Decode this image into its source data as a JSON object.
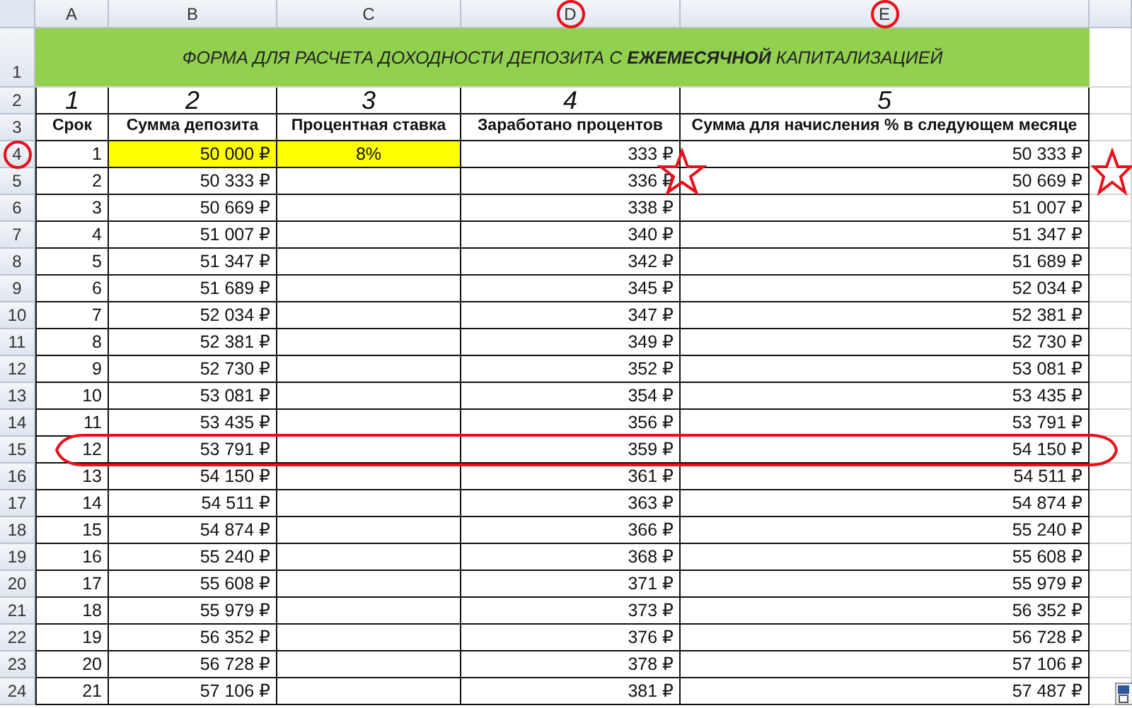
{
  "columns": [
    "A",
    "B",
    "C",
    "D",
    "E"
  ],
  "title": "ФОРМА ДЛЯ РАСЧЕТА ДОХОДНОСТИ ДЕПОЗИТА С **ЕЖЕМЕСЯЧНОЙ** КАПИТАЛИЗАЦИЕЙ",
  "column_numbers": [
    "1",
    "2",
    "3",
    "4",
    "5"
  ],
  "headers": [
    "Срок",
    "Сумма депозита",
    "Процентная ставка",
    "Заработано процентов",
    "Сумма для начисления % в следующем месяце"
  ],
  "rows": [
    {
      "term": "1",
      "deposit": "50 000 ₽",
      "rate": "8%",
      "interest": "333 ₽",
      "next": "50 333 ₽",
      "highlighted": true
    },
    {
      "term": "2",
      "deposit": "50 333 ₽",
      "interest": "336 ₽",
      "next": "50 669 ₽",
      "highlighted": false
    },
    {
      "term": "3",
      "deposit": "50 669 ₽",
      "interest": "338 ₽",
      "next": "51 007 ₽",
      "highlighted": false
    },
    {
      "term": "4",
      "deposit": "51 007 ₽",
      "interest": "340 ₽",
      "next": "51 347 ₽",
      "highlighted": false
    },
    {
      "term": "5",
      "deposit": "51 347 ₽",
      "interest": "342 ₽",
      "next": "51 689 ₽",
      "highlighted": false
    },
    {
      "term": "6",
      "deposit": "51 689 ₽",
      "interest": "345 ₽",
      "next": "52 034 ₽",
      "highlighted": false
    },
    {
      "term": "7",
      "deposit": "52 034 ₽",
      "interest": "347 ₽",
      "next": "52 381 ₽",
      "highlighted": false
    },
    {
      "term": "8",
      "deposit": "52 381 ₽",
      "interest": "349 ₽",
      "next": "52 730 ₽",
      "highlighted": false
    },
    {
      "term": "9",
      "deposit": "52 730 ₽",
      "interest": "352 ₽",
      "next": "53 081 ₽",
      "highlighted": false
    },
    {
      "term": "10",
      "deposit": "53 081 ₽",
      "interest": "354 ₽",
      "next": "53 435 ₽",
      "highlighted": false
    },
    {
      "term": "11",
      "deposit": "53 435 ₽",
      "interest": "356 ₽",
      "next": "53 791 ₽",
      "highlighted": false
    },
    {
      "term": "12",
      "deposit": "53 791 ₽",
      "interest": "359 ₽",
      "next": "54 150 ₽",
      "highlighted": false
    },
    {
      "term": "13",
      "deposit": "54 150 ₽",
      "interest": "361 ₽",
      "next": "54 511 ₽",
      "highlighted": false
    },
    {
      "term": "14",
      "deposit": "54 511 ₽",
      "interest": "363 ₽",
      "next": "54 874 ₽",
      "highlighted": false
    },
    {
      "term": "15",
      "deposit": "54 874 ₽",
      "interest": "366 ₽",
      "next": "55 240 ₽",
      "highlighted": false
    },
    {
      "term": "16",
      "deposit": "55 240 ₽",
      "interest": "368 ₽",
      "next": "55 608 ₽",
      "highlighted": false
    },
    {
      "term": "17",
      "deposit": "55 608 ₽",
      "interest": "371 ₽",
      "next": "55 979 ₽",
      "highlighted": false
    },
    {
      "term": "18",
      "deposit": "55 979 ₽",
      "interest": "373 ₽",
      "next": "56 352 ₽",
      "highlighted": false
    },
    {
      "term": "19",
      "deposit": "56 352 ₽",
      "interest": "376 ₽",
      "next": "56 728 ₽",
      "highlighted": false
    },
    {
      "term": "20",
      "deposit": "56 728 ₽",
      "interest": "378 ₽",
      "next": "57 106 ₽",
      "highlighted": false
    },
    {
      "term": "21",
      "deposit": "57 106 ₽",
      "interest": "381 ₽",
      "next": "57 487 ₽",
      "highlighted": false
    }
  ],
  "row_numbers": [
    "1",
    "2",
    "3",
    "4",
    "5",
    "6",
    "7",
    "8",
    "9",
    "10",
    "11",
    "12",
    "13",
    "14",
    "15",
    "16",
    "17",
    "18",
    "19",
    "20",
    "21",
    "22",
    "23",
    "24"
  ]
}
